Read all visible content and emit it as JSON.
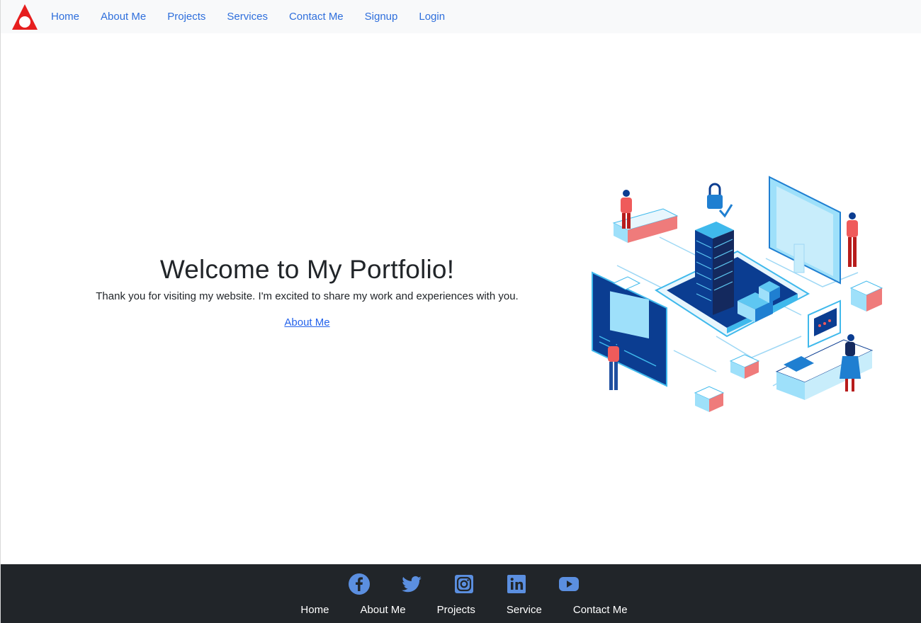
{
  "navbar": {
    "logo_icon": "red-triangle-logo",
    "links": [
      "Home",
      "About Me",
      "Projects",
      "Services",
      "Contact Me",
      "Signup",
      "Login"
    ],
    "link_color": "#2f6fdc"
  },
  "hero": {
    "title": "Welcome to My Portfolio!",
    "subtitle": "Thank you for visiting my website. I'm excited to share my work and experiences with you.",
    "link_label": "About Me",
    "illustration": "isometric-city-tech-illustration"
  },
  "footer": {
    "social_icons": [
      "facebook-icon",
      "twitter-icon",
      "instagram-icon",
      "linkedin-icon",
      "youtube-icon"
    ],
    "links": [
      "Home",
      "About Me",
      "Projects",
      "Service",
      "Contact Me"
    ],
    "background": "#212529",
    "icon_color": "#5b8fe0"
  }
}
